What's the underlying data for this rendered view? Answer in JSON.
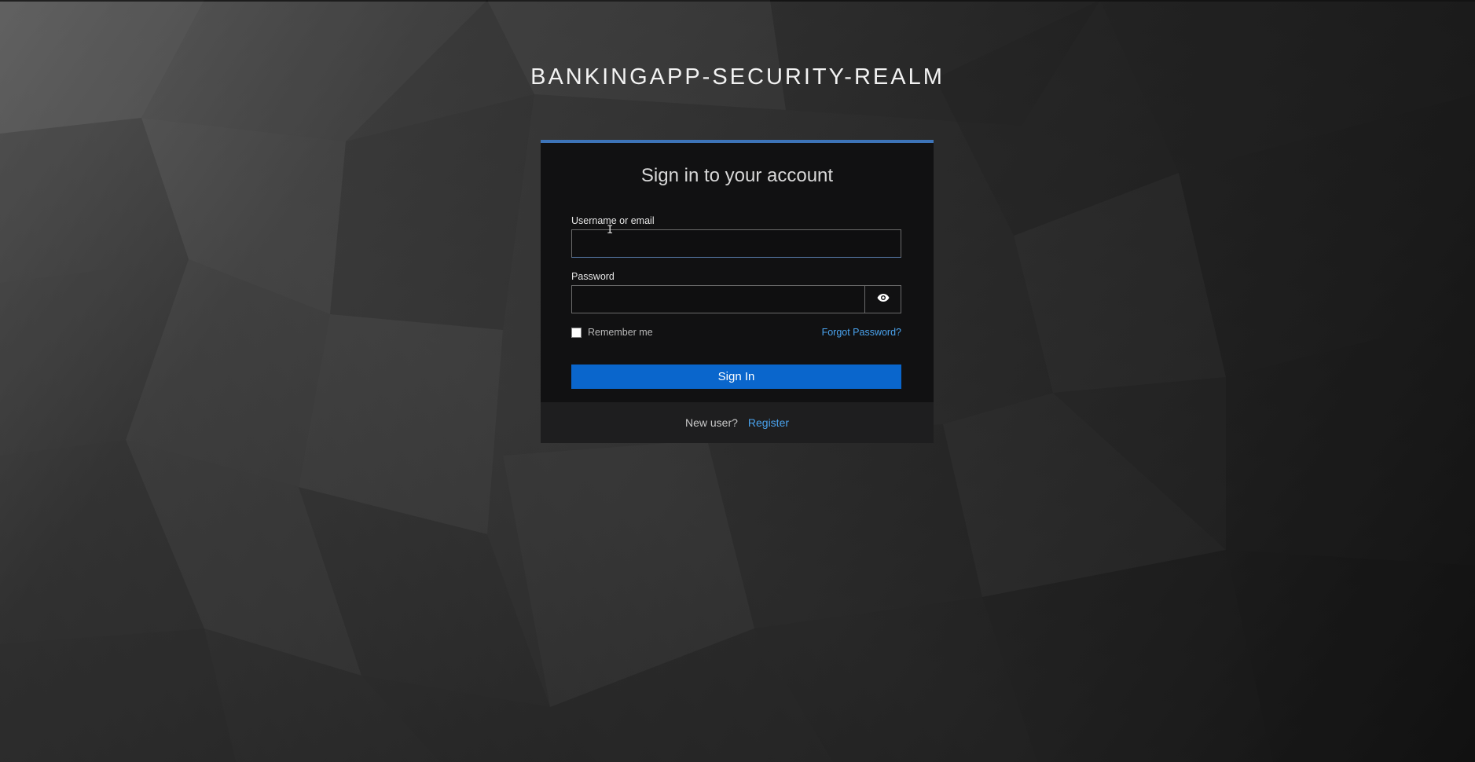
{
  "realm": {
    "title": "BANKINGAPP-SECURITY-REALM"
  },
  "login_card": {
    "heading": "Sign in to your account",
    "accent_color": "#3d74b8",
    "username": {
      "label": "Username or email",
      "value": ""
    },
    "password": {
      "label": "Password",
      "value": "",
      "reveal_icon": "eye-icon"
    },
    "remember_me": {
      "label": "Remember me",
      "checked": false
    },
    "forgot_password_label": "Forgot Password?",
    "submit_label": "Sign In",
    "submit_color": "#0a66cc"
  },
  "footer": {
    "new_user_text": "New user?",
    "register_label": "Register",
    "link_color": "#4aa3ee"
  }
}
